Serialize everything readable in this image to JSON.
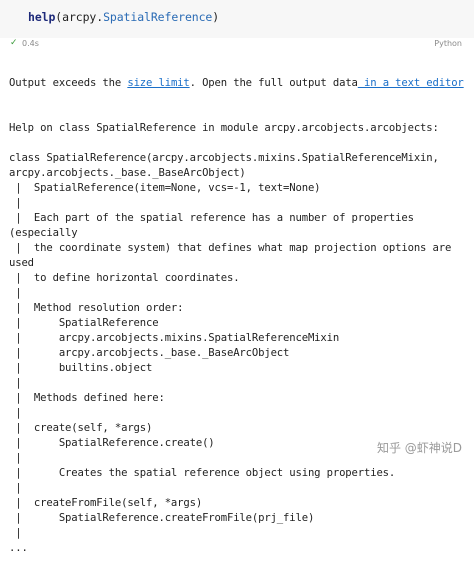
{
  "cell": {
    "call_prefix": "help",
    "call_open": "(",
    "call_module": "arcpy.",
    "call_class": "SpatialReference",
    "call_close": ")",
    "status_check": "✓",
    "exec_time": "0.4s",
    "language": "Python"
  },
  "output": {
    "notice_prefix": "Output exceeds the ",
    "size_limit_link": "size limit",
    "notice_mid": ". Open the full output data",
    "text_editor_link": " in a text editor",
    "lines": [
      "Help on class SpatialReference in module arcpy.arcobjects.arcobjects:",
      "",
      "class SpatialReference(arcpy.arcobjects.mixins.SpatialReferenceMixin,",
      "arcpy.arcobjects._base._BaseArcObject)",
      " |  SpatialReference(item=None, vcs=-1, text=None)",
      " |",
      " |  Each part of the spatial reference has a number of properties",
      "(especially",
      " |  the coordinate system) that defines what map projection options are",
      "used",
      " |  to define horizontal coordinates.",
      " |",
      " |  Method resolution order:",
      " |      SpatialReference",
      " |      arcpy.arcobjects.mixins.SpatialReferenceMixin",
      " |      arcpy.arcobjects._base._BaseArcObject",
      " |      builtins.object",
      " |",
      " |  Methods defined here:",
      " |",
      " |  create(self, *args)",
      " |      SpatialReference.create()",
      " |",
      " |      Creates the spatial reference object using properties.",
      " |",
      " |  createFromFile(self, *args)",
      " |      SpatialReference.createFromFile(prj_file)",
      " |",
      "..."
    ]
  },
  "watermark": "知乎 @虾神说D"
}
